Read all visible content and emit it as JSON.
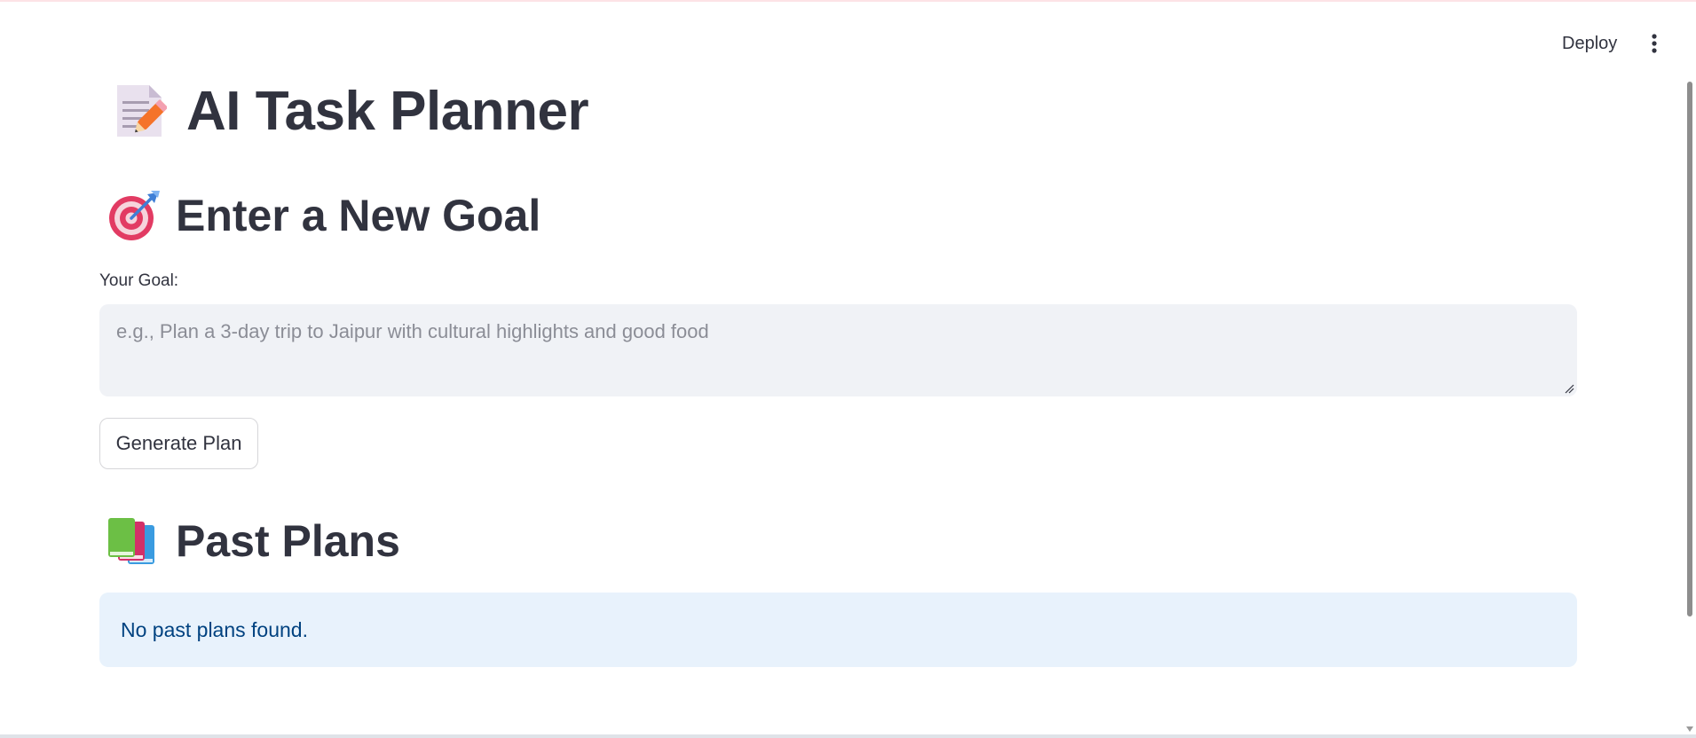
{
  "header": {
    "deploy_label": "Deploy",
    "menu_icon": "more-vertical-icon"
  },
  "main": {
    "title": "AI Task Planner",
    "title_icon": "memo-icon",
    "goal_section": {
      "heading": "Enter a New Goal",
      "heading_icon": "target-icon",
      "input_label": "Your Goal:",
      "input_value": "",
      "input_placeholder": "e.g., Plan a 3-day trip to Jaipur with cultural highlights and good food",
      "button_label": "Generate Plan"
    },
    "past_section": {
      "heading": "Past Plans",
      "heading_icon": "books-icon",
      "info_message": "No past plans found."
    }
  },
  "colors": {
    "text": "#31333f",
    "input_bg": "#f0f2f6",
    "info_bg": "#e8f2fc",
    "info_text": "#004280",
    "placeholder": "#8b8d96"
  }
}
